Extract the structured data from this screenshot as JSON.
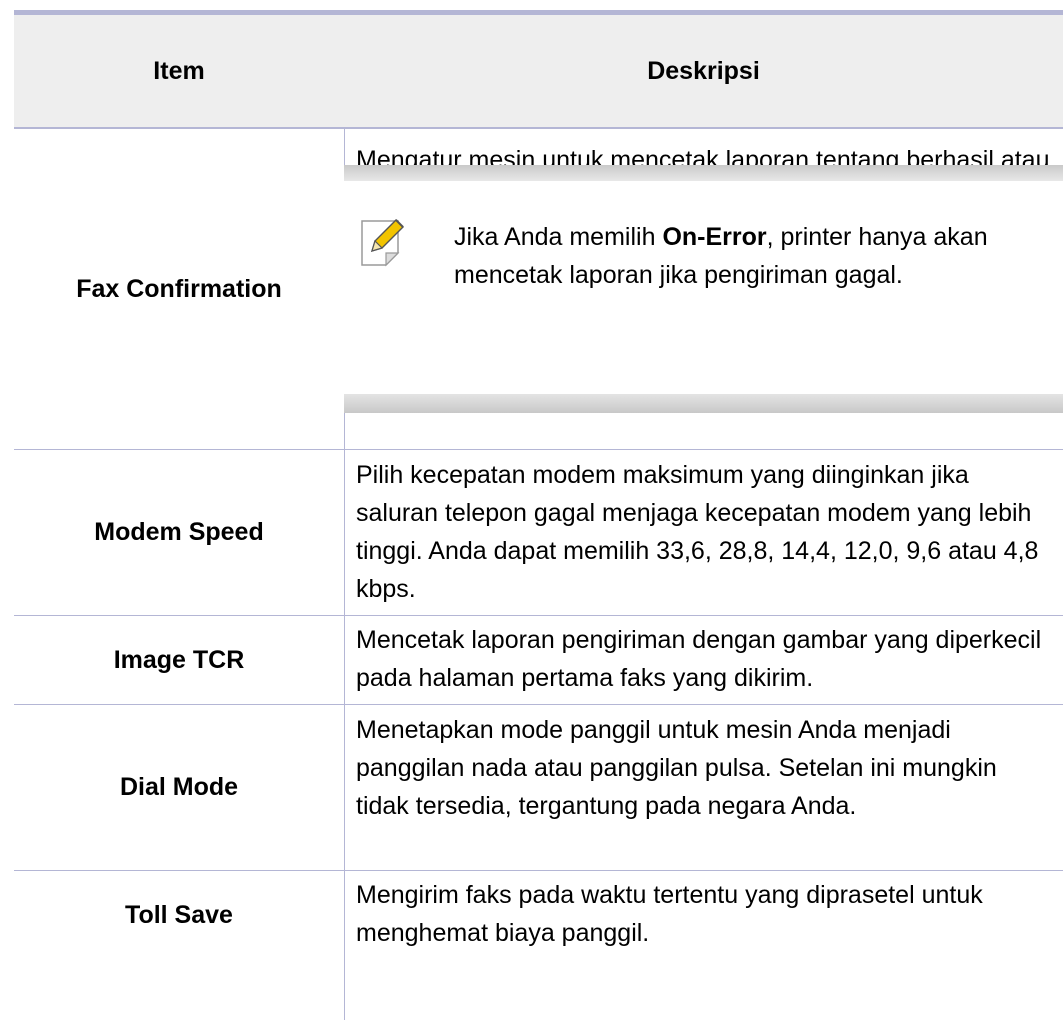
{
  "table": {
    "header": {
      "item": "Item",
      "description": "Deskripsi"
    },
    "rows": [
      {
        "item": "Fax Confirmation",
        "description": "Mengatur mesin untuk mencetak laporan tentang berhasil atau tidaknya pengiriman faks.",
        "note": {
          "icon": "note-pencil-icon",
          "before": "Jika Anda memilih ",
          "bold": "On-Error",
          "after": ", printer hanya akan mencetak laporan jika pengiriman gagal."
        }
      },
      {
        "item": "Modem Speed",
        "description": "Pilih kecepatan modem maksimum yang diinginkan jika saluran telepon gagal menjaga kecepatan modem yang lebih tinggi. Anda dapat memilih 33,6, 28,8, 14,4, 12,0, 9,6 atau 4,8 kbps."
      },
      {
        "item": "Image TCR",
        "description": "Mencetak laporan pengiriman dengan gambar yang diperkecil pada halaman pertama faks yang dikirim."
      },
      {
        "item": "Dial Mode",
        "description": "Menetapkan mode panggil untuk mesin Anda menjadi panggilan nada atau panggilan pulsa. Setelan ini mungkin tidak tersedia, tergantung pada negara Anda."
      },
      {
        "item": "Toll Save",
        "description": "Mengirim faks pada waktu tertentu yang diprasetel untuk menghemat biaya panggil."
      }
    ]
  },
  "colors": {
    "rule": "#b4b6d5",
    "header_bg": "#eeeeee",
    "note_bar": "#d0d0d0",
    "icon_accent": "#f2c400"
  }
}
